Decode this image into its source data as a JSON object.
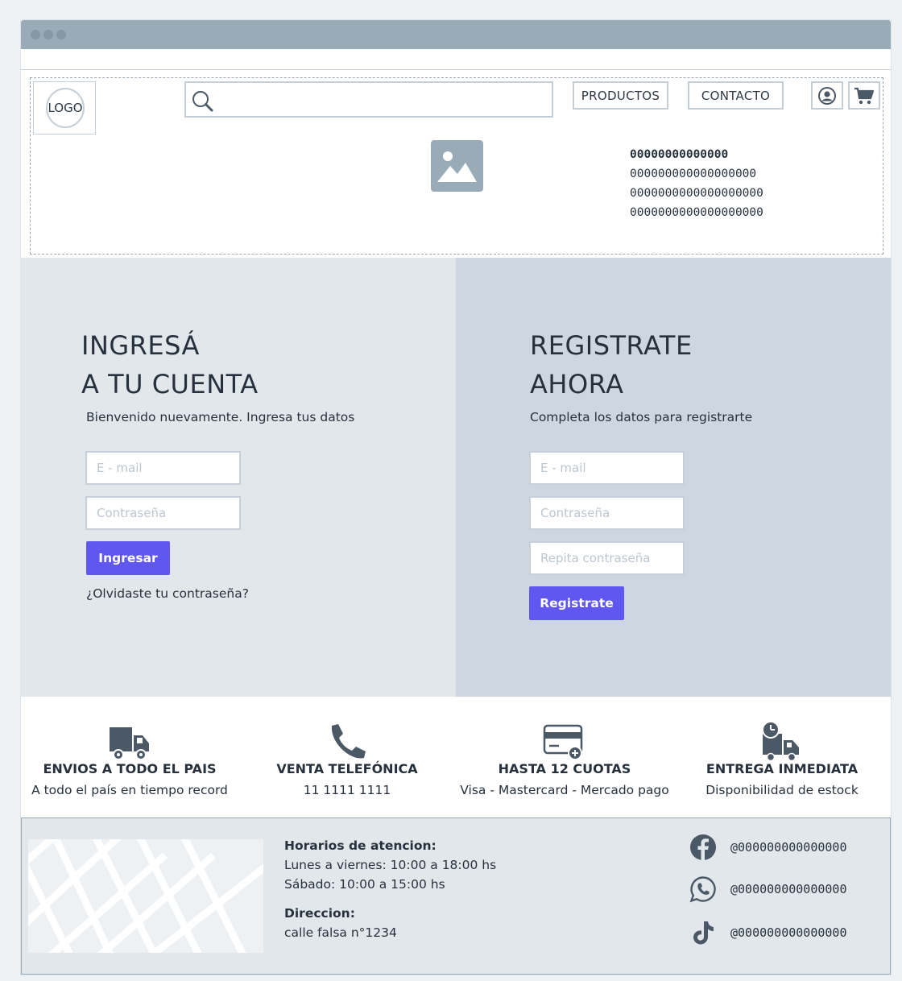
{
  "header": {
    "logo_label": "LOGO",
    "search": {
      "placeholder": ""
    },
    "nav": [
      {
        "label": "PRODUCTOS"
      },
      {
        "label": "CONTACTO"
      }
    ],
    "icons": [
      "user-circle-icon",
      "cart-icon"
    ],
    "text_block": [
      "00000000000000",
      "000000000000000000",
      "0000000000000000000",
      "0000000000000000000"
    ]
  },
  "login": {
    "title_line1": "INGRESÁ",
    "title_line2": "A TU CUENTA",
    "subtitle": "Bienvenido nuevamente. Ingresa tus datos",
    "email_placeholder": "E - mail",
    "password_placeholder": "Contraseña",
    "submit_label": "Ingresar",
    "forgot_label": "¿Olvidaste tu contraseña?"
  },
  "register": {
    "title_line1": "REGISTRATE",
    "title_line2": "AHORA",
    "subtitle": "Completa los datos para registrarte",
    "email_placeholder": "E - mail",
    "password_placeholder": "Contraseña",
    "repeat_placeholder": "Repita contraseña",
    "submit_label": "Registrate"
  },
  "features": [
    {
      "icon": "truck-icon",
      "title": "ENVIOS A TODO EL PAIS",
      "subtitle": "A todo el país en tiempo record"
    },
    {
      "icon": "phone-icon",
      "title": "VENTA TELEFÓNICA",
      "subtitle": "11 1111 1111"
    },
    {
      "icon": "credit-card-icon",
      "title": "HASTA 12 CUOTAS",
      "subtitle": "Visa - Mastercard - Mercado pago"
    },
    {
      "icon": "truck-clock-icon",
      "title": "ENTREGA INMEDIATA",
      "subtitle": "Disponibilidad de estock"
    }
  ],
  "footer": {
    "hours_title": "Horarios de atencion:",
    "hours_weekdays": "Lunes a viernes: 10:00 a 18:00 hs",
    "hours_saturday": "Sábado: 10:00 a 15:00 hs",
    "address_title": "Direccion:",
    "address": "calle falsa n°1234",
    "social": [
      {
        "icon": "facebook-icon",
        "handle": "@000000000000000"
      },
      {
        "icon": "whatsapp-icon",
        "handle": "@000000000000000"
      },
      {
        "icon": "tiktok-icon",
        "handle": "@000000000000000"
      }
    ]
  },
  "colors": {
    "primary": "#6057f0",
    "titlebar": "#9aabb8",
    "login_bg": "#e2e7ec",
    "register_bg": "#ced7df",
    "icon": "#4b5866"
  }
}
